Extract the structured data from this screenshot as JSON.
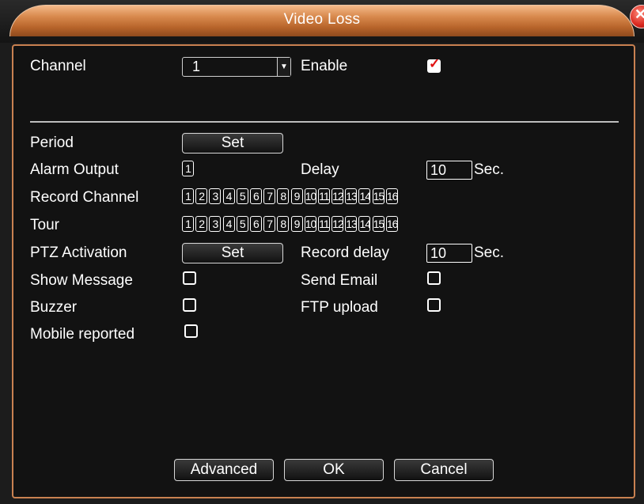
{
  "window": {
    "title": "Video Loss"
  },
  "labels": {
    "channel": "Channel",
    "enable": "Enable",
    "period": "Period",
    "alarm_output": "Alarm Output",
    "delay": "Delay",
    "record_channel": "Record Channel",
    "tour": "Tour",
    "ptz_activation": "PTZ Activation",
    "record_delay": "Record delay",
    "show_message": "Show Message",
    "send_email": "Send Email",
    "buzzer": "Buzzer",
    "ftp_upload": "FTP upload",
    "mobile_reported": "Mobile reported",
    "sec1": "Sec.",
    "sec2": "Sec."
  },
  "channel_select": {
    "value": "1"
  },
  "enable_checked": true,
  "alarm_output_box": "1",
  "delay_value": "10",
  "record_delay_value": "10",
  "channels": [
    "1",
    "2",
    "3",
    "4",
    "5",
    "6",
    "7",
    "8",
    "9",
    "10",
    "11",
    "12",
    "13",
    "14",
    "15",
    "16"
  ],
  "buttons": {
    "period_set": "Set",
    "ptz_set": "Set",
    "advanced": "Advanced",
    "ok": "OK",
    "cancel": "Cancel"
  },
  "checkboxes": {
    "show_message": false,
    "send_email": false,
    "buzzer": false,
    "ftp_upload": false,
    "mobile_reported": false
  }
}
